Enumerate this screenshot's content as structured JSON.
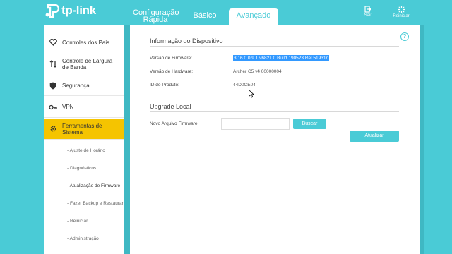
{
  "brand": {
    "name": "tp-link"
  },
  "tabs": {
    "config_line1": "Configuração",
    "config_line2": "Rápida",
    "basic": "Básico",
    "advanced": "Avançado"
  },
  "header_buttons": {
    "logout": "Sair",
    "reboot": "Reiniciar"
  },
  "sidebar": {
    "items": [
      {
        "label": "Controles dos Pais",
        "icon": "heart-icon"
      },
      {
        "label": "Controle de Largura de Banda",
        "icon": "bandwidth-icon"
      },
      {
        "label": "Segurança",
        "icon": "shield-icon"
      },
      {
        "label": "VPN",
        "icon": "vpn-icon"
      },
      {
        "label": "Ferramentas de Sistema",
        "icon": "gear-icon"
      }
    ],
    "sub_items": [
      "- Ajuste de Horário",
      "- Diagnósticos",
      "- Atualização de Firmware",
      "- Fazer Backup e Restaurar",
      "- Reiniciar",
      "- Administração"
    ]
  },
  "device_info": {
    "title": "Informação do Dispositivo",
    "firmware_label": "Versão de Firmware:",
    "firmware_value": "3.16.0 0.9.1 v6821.0 Build 190523 Rel.51931n",
    "hardware_label": "Versão de Hardware:",
    "hardware_value": "Archer C5 v4 00000004",
    "product_label": "ID do Produto:",
    "product_value": "44D0CE04"
  },
  "local_upgrade": {
    "title": "Upgrade Local",
    "file_label": "Novo Arquivo Firmware:",
    "file_value": "",
    "browse_button": "Buscar",
    "update_button": "Atualizar"
  },
  "colors": {
    "accent": "#4acbd6",
    "active": "#f5c400",
    "selection": "#3399ff"
  }
}
